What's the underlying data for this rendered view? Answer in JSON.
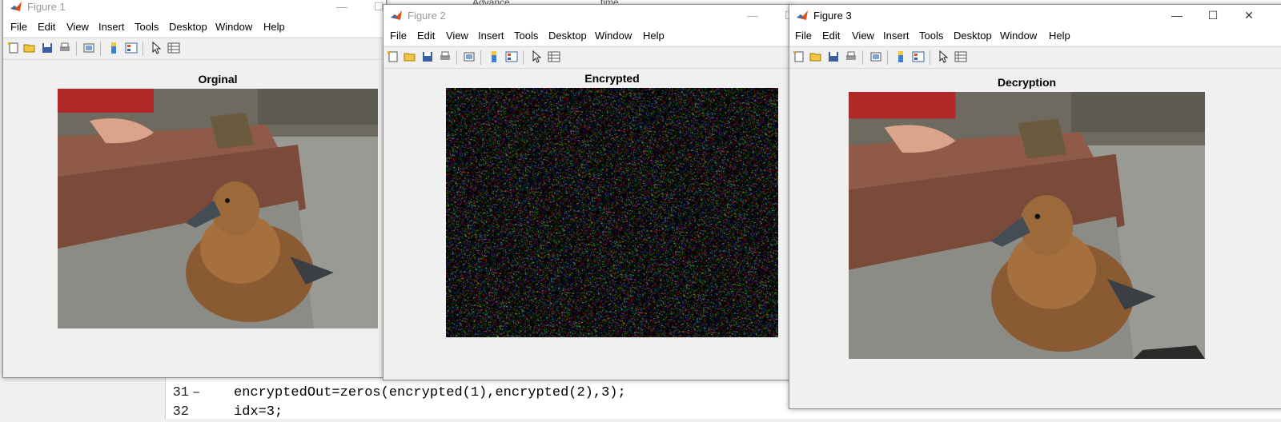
{
  "editor": {
    "header_a": "Advance",
    "header_b": "time",
    "lines": [
      {
        "num": "31",
        "marker": "–",
        "code": "encryptedOut=zeros(encrypted(1),encrypted(2),3);"
      },
      {
        "num": "32",
        "marker": "",
        "code": "idx=3;"
      }
    ]
  },
  "windows": [
    {
      "title": "Figure 1",
      "axes_title": "Orginal"
    },
    {
      "title": "Figure 2",
      "axes_title": "Encrypted"
    },
    {
      "title": "Figure 3",
      "axes_title": "Decryption"
    }
  ],
  "menu": [
    "File",
    "Edit",
    "View",
    "Insert",
    "Tools",
    "Desktop",
    "Window",
    "Help"
  ],
  "toolbar_icons": [
    "new-figure-icon",
    "open-file-icon",
    "save-icon",
    "print-icon",
    "print-preview-icon",
    "colorbar-icon",
    "legend-icon",
    "pointer-icon",
    "property-inspector-icon"
  ],
  "colors": {
    "accent": "#d95319",
    "window_bg": "#f0f0f0"
  }
}
